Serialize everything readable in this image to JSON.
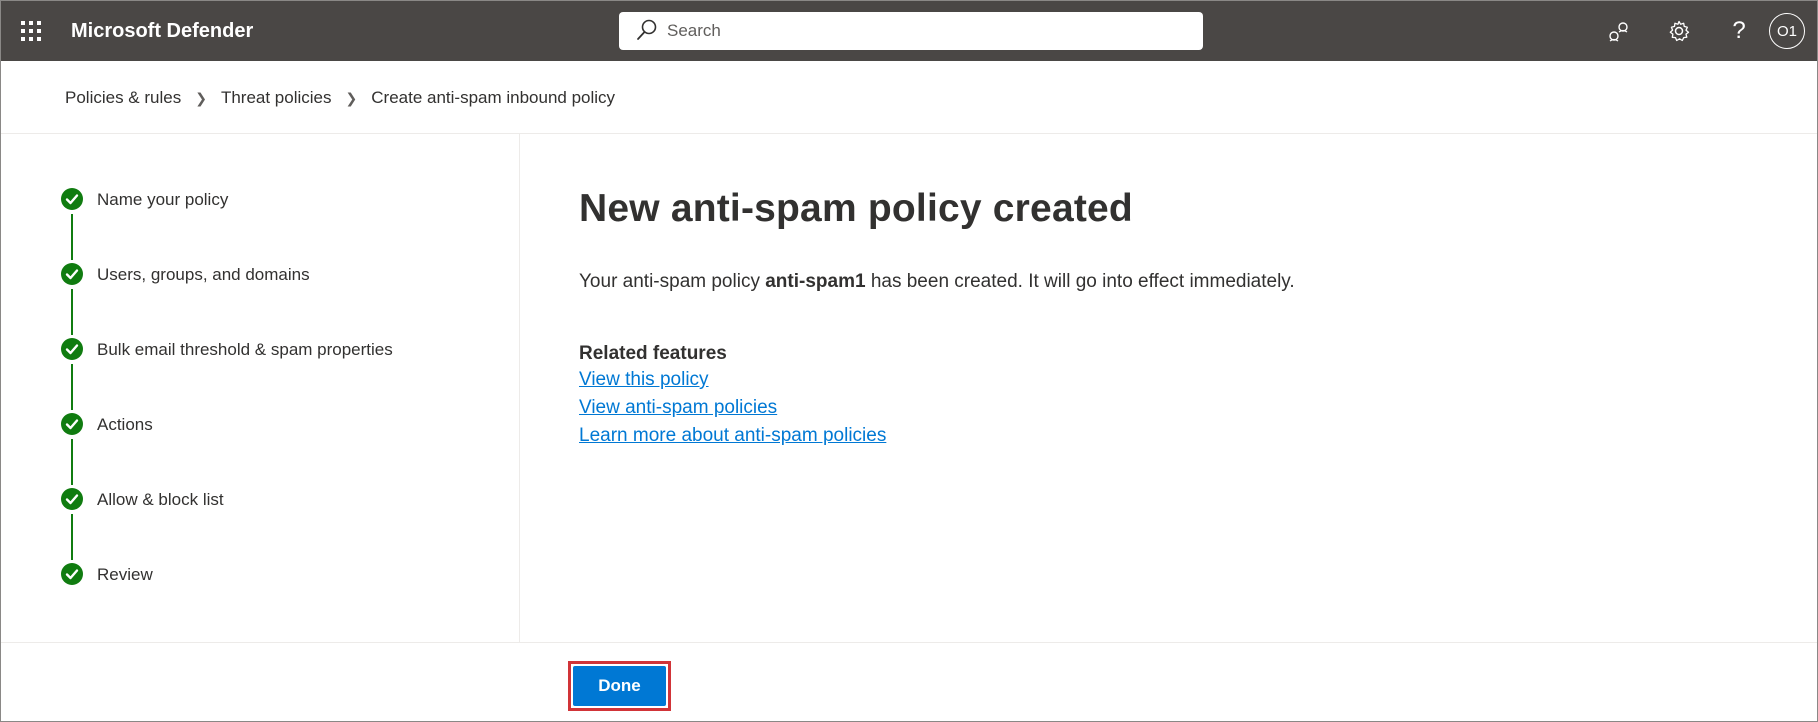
{
  "header": {
    "app_title": "Microsoft Defender",
    "search_placeholder": "Search",
    "avatar_initials": "O1",
    "icons": [
      "app-launcher-icon",
      "search-icon",
      "community-icon",
      "settings-gear-icon",
      "help-icon"
    ]
  },
  "breadcrumb": {
    "items": [
      "Policies & rules",
      "Threat policies",
      "Create anti-spam inbound policy"
    ]
  },
  "steps": [
    {
      "label": "Name your policy",
      "status": "complete"
    },
    {
      "label": "Users, groups, and domains",
      "status": "complete"
    },
    {
      "label": "Bulk email threshold & spam properties",
      "status": "complete"
    },
    {
      "label": "Actions",
      "status": "complete"
    },
    {
      "label": "Allow & block list",
      "status": "complete"
    },
    {
      "label": "Review",
      "status": "complete"
    }
  ],
  "main": {
    "title": "New anti-spam policy created",
    "message_prefix": "Your anti-spam policy ",
    "policy_name": "anti-spam1",
    "message_suffix": " has been created. It will go into effect immediately.",
    "related_title": "Related features",
    "links": [
      "View this policy",
      "View anti-spam policies",
      "Learn more about anti-spam policies"
    ]
  },
  "footer": {
    "done_label": "Done"
  },
  "colors": {
    "header_bg": "#4a4745",
    "step_complete": "#107c10",
    "link": "#0078d4",
    "primary_button": "#0078d4",
    "highlight": "#d13438"
  }
}
